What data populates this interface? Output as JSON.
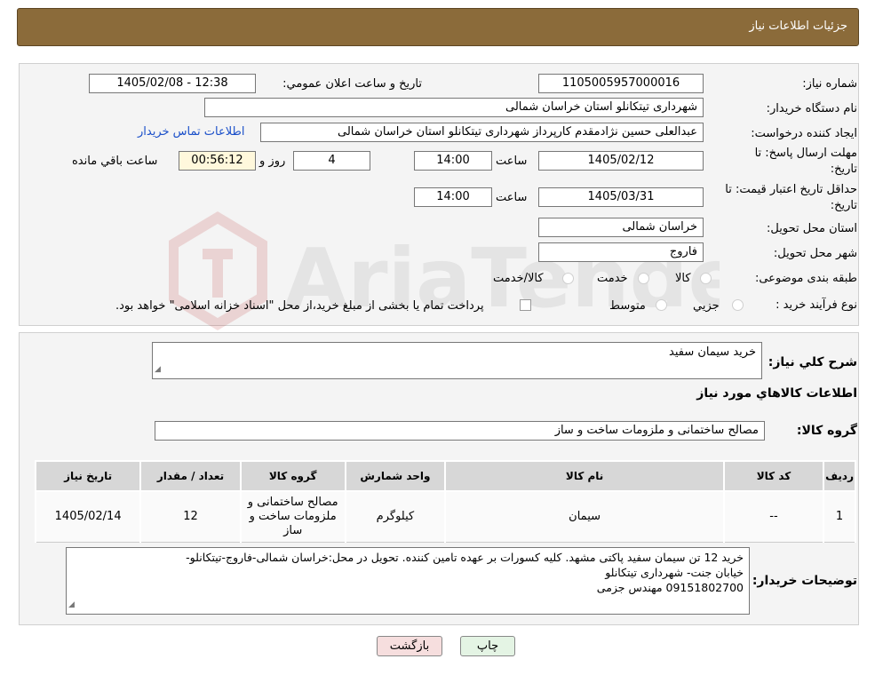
{
  "title": "جزئیات اطلاعات نیاز",
  "watermark": "AriaTender.neT",
  "form": {
    "need_number_label": "شماره نیاز:",
    "need_number": "1105005957000016",
    "announce_label": "تاريخ و ساعت اعلان عمومي:",
    "announce_value": "1405/02/08 - 12:38",
    "buyer_org_label": "نام دستگاه خريدار:",
    "buyer_org": "شهرداری تیتکانلو استان خراسان شمالی",
    "creator_label": "ايجاد کننده درخواست:",
    "creator": "عبدالعلی حسین نژادمقدم کارپرداز شهرداری تیتکانلو استان خراسان شمالی",
    "contact_link": "اطلاعات تماس خريدار",
    "deadline_label": "مهلت ارسال پاسخ: تا تاريخ:",
    "deadline_date": "1405/02/12",
    "time_label": "ساعت",
    "deadline_time": "14:00",
    "days_value": "4",
    "days_label": "روز و",
    "remaining_time": "00:56:12",
    "remaining_label": "ساعت باقي مانده",
    "validity_label": "حداقل تاريخ اعتبار قيمت: تا تاريخ:",
    "validity_date": "1405/03/31",
    "validity_time": "14:00",
    "province_label": "استان محل تحويل:",
    "province": "خراسان شمالی",
    "city_label": "شهر محل تحويل:",
    "city": "فاروج",
    "category_label": "طبقه بندی موضوعی:",
    "category_options": [
      "کالا",
      "خدمت",
      "کالا/خدمت"
    ],
    "process_label": "نوع فرآيند خريد :",
    "process_options": [
      "جزيي",
      "متوسط"
    ],
    "process_note": "پرداخت تمام يا بخشی از مبلغ خريد،از محل \"اسناد خزانه اسلامی\" خواهد بود."
  },
  "summary": {
    "desc_label": "شرح کلي نياز:",
    "desc_value": "خرید سیمان سفید",
    "items_heading": "اطلاعات کالاهاي مورد نياز",
    "group_label": "گروه کالا:",
    "group_value": "مصالح ساختمانی و ملزومات ساخت و ساز"
  },
  "table": {
    "headers": [
      "رديف",
      "کد کالا",
      "نام کالا",
      "واحد شمارش",
      "گروه کالا",
      "تعداد / مقدار",
      "تاريخ نياز"
    ],
    "row": {
      "index": "1",
      "code": "--",
      "name": "سیمان",
      "unit": "کیلوگرم",
      "group": "مصالح ساختمانی و ملزومات ساخت و ساز",
      "qty": "12",
      "date": "1405/02/14"
    }
  },
  "notes": {
    "label": "توضيحات خريدار:",
    "line1": "خرید 12 تن سیمان سفید پاکتی مشهد. کلیه کسورات بر عهده تامین کننده. تحویل در محل:خراسان شمالی-فاروج-تیتکانلو-",
    "line2": "خیابان جنت- شهرداری تیتکانلو",
    "line3": "09151802700 مهندس جزمی"
  },
  "buttons": {
    "print": "چاپ",
    "back": "بازگشت"
  },
  "colors": {
    "header": "#8b6b3a",
    "back_button": "#f6dede",
    "print_button": "#e4f4e4",
    "link": "#1a4fc9"
  }
}
